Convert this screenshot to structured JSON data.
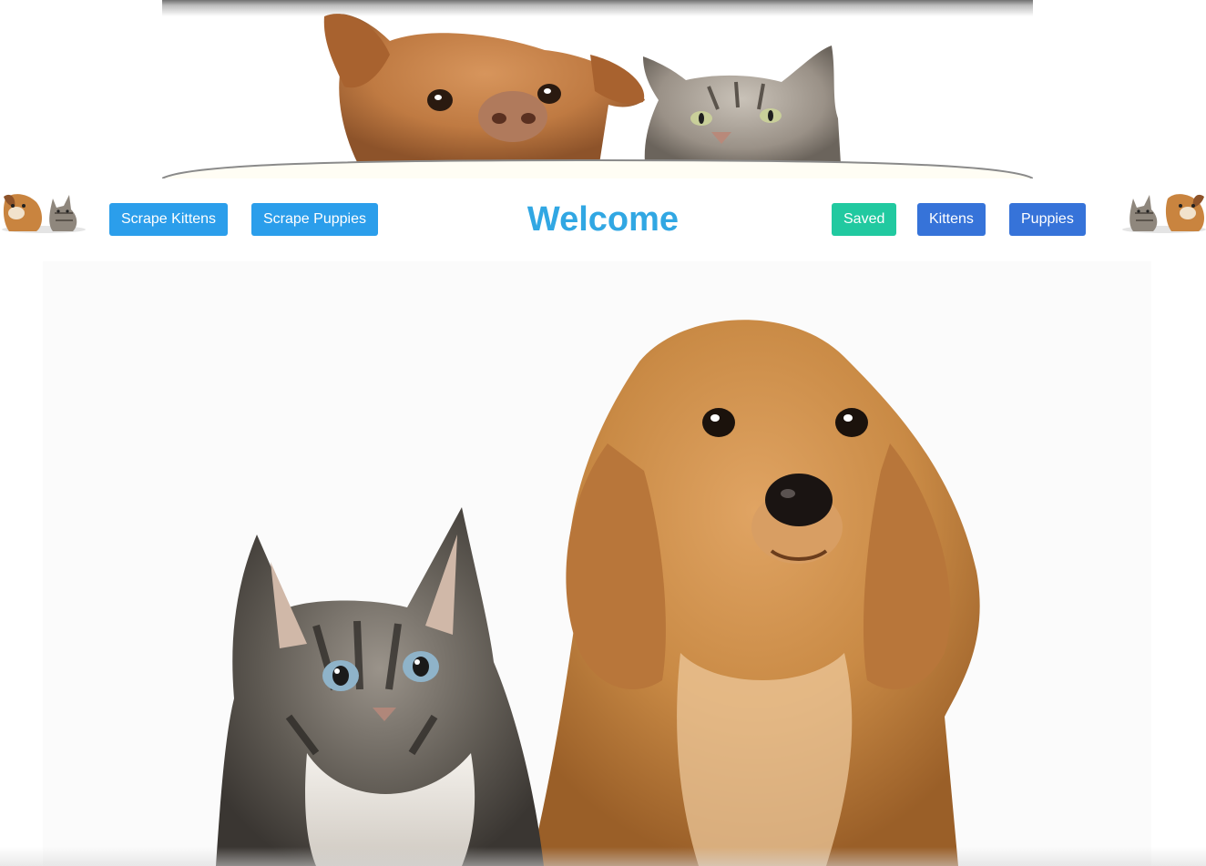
{
  "nav": {
    "left_buttons": [
      {
        "label": "Scrape Kittens",
        "color": "#2b9eeb"
      },
      {
        "label": "Scrape Puppies",
        "color": "#2b9eeb"
      }
    ],
    "title": "Welcome",
    "right_buttons": [
      {
        "label": "Saved",
        "color": "#21c9a0"
      },
      {
        "label": "Kittens",
        "color": "#3673d9"
      },
      {
        "label": "Puppies",
        "color": "#3673d9"
      }
    ]
  },
  "images": {
    "banner": "dog-and-cat-peeking-banner",
    "hero": "kitten-and-puppy-photo",
    "corner_icon": "dog-and-cat-icon"
  },
  "colors": {
    "title": "#31a7e3",
    "info_button": "#2b9eeb",
    "success_button": "#21c9a0",
    "link_button": "#3673d9"
  }
}
